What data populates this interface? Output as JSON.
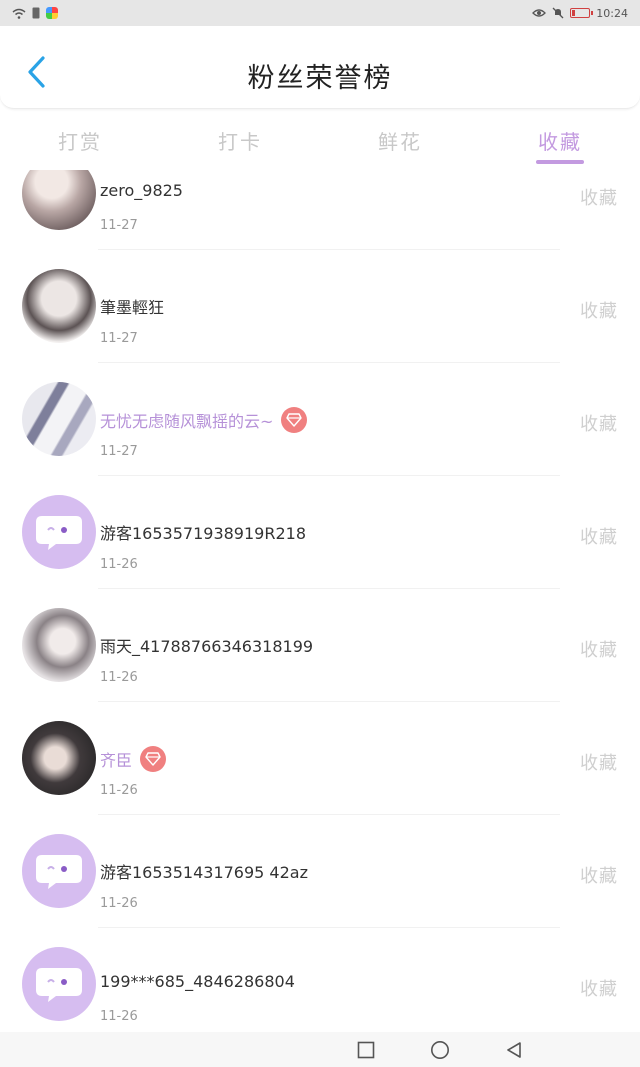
{
  "status_bar": {
    "time": "10:24",
    "left_icons": [
      "wifi-icon",
      "sim-icon",
      "app-icon"
    ],
    "right_icons": [
      "eye-icon",
      "mute-icon",
      "battery-icon"
    ]
  },
  "header": {
    "title": "粉丝荣誉榜",
    "back_icon": "chevron-left-icon"
  },
  "tabs": [
    {
      "label": "打赏",
      "active": false
    },
    {
      "label": "打卡",
      "active": false
    },
    {
      "label": "鲜花",
      "active": false
    },
    {
      "label": "收藏",
      "active": true
    }
  ],
  "accent_color": "#c39ae0",
  "list": [
    {
      "name": "zero_9825",
      "date": "11-27",
      "vip": false,
      "avatar": "photo1",
      "action": "收藏"
    },
    {
      "name": "筆墨輕狂",
      "date": "11-27",
      "vip": false,
      "avatar": "photo2",
      "action": "收藏"
    },
    {
      "name": "无忧无虑随风飘摇的云~",
      "date": "11-27",
      "vip": true,
      "avatar": "photo3",
      "action": "收藏"
    },
    {
      "name": "游客1653571938919R218",
      "date": "11-26",
      "vip": false,
      "avatar": "default",
      "action": "收藏"
    },
    {
      "name": "雨天_41788766346318199",
      "date": "11-26",
      "vip": false,
      "avatar": "photo4",
      "action": "收藏"
    },
    {
      "name": "齐臣",
      "date": "11-26",
      "vip": true,
      "avatar": "photo5",
      "action": "收藏"
    },
    {
      "name": "游客1653514317695 42az",
      "date": "11-26",
      "vip": false,
      "avatar": "default",
      "action": "收藏"
    },
    {
      "name": "199***685_4846286804",
      "date": "11-26",
      "vip": false,
      "avatar": "default",
      "action": "收藏"
    }
  ],
  "nav_bar": [
    "recents-square-icon",
    "home-circle-icon",
    "back-triangle-icon"
  ]
}
